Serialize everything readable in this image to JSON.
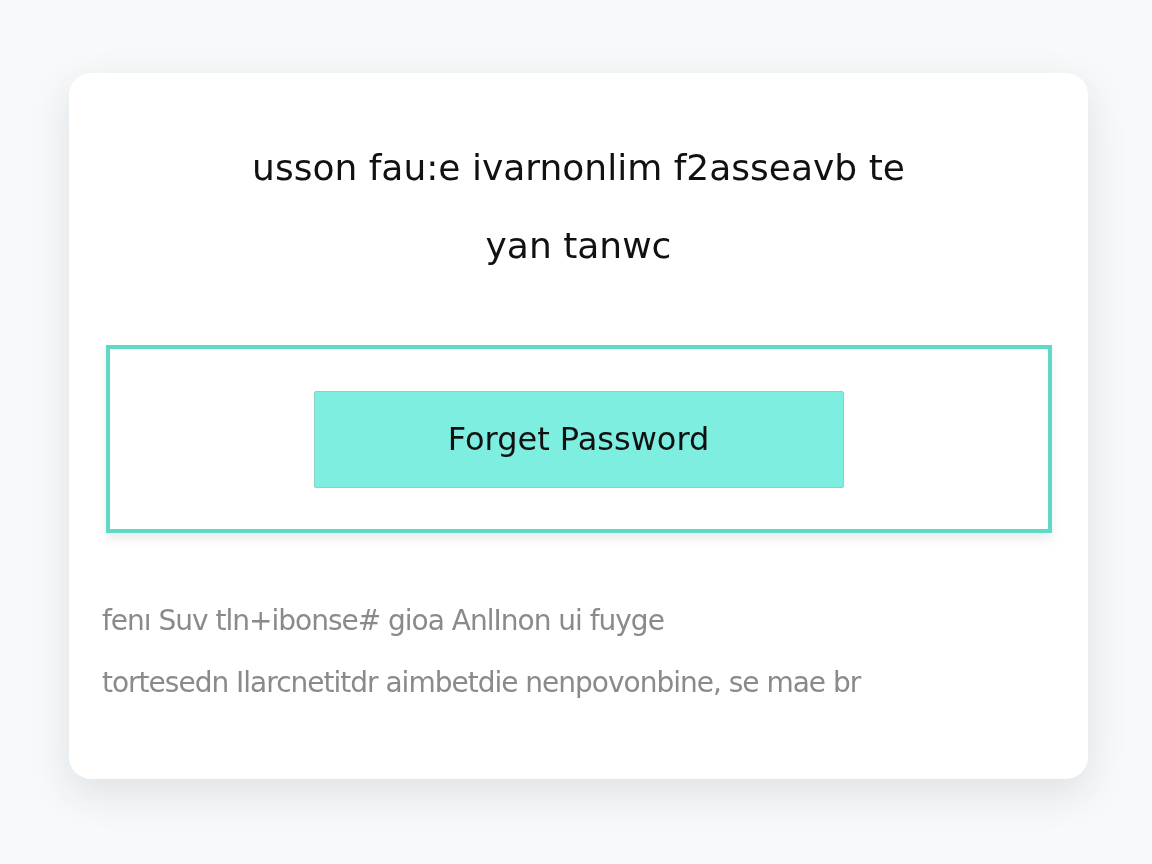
{
  "card": {
    "title_lines": [
      "usson fau:e ivarnonlim  f2asseavb te",
      "yan tanwc"
    ],
    "action_box": {
      "button": "Forget Password"
    },
    "body_lines": [
      "fenı Suv tln+ibonse# gioa AnlInon ui fuyge",
      "tortesedn Ilarcnetitdr aimbetdie nenpovonbine, se mae br"
    ]
  }
}
